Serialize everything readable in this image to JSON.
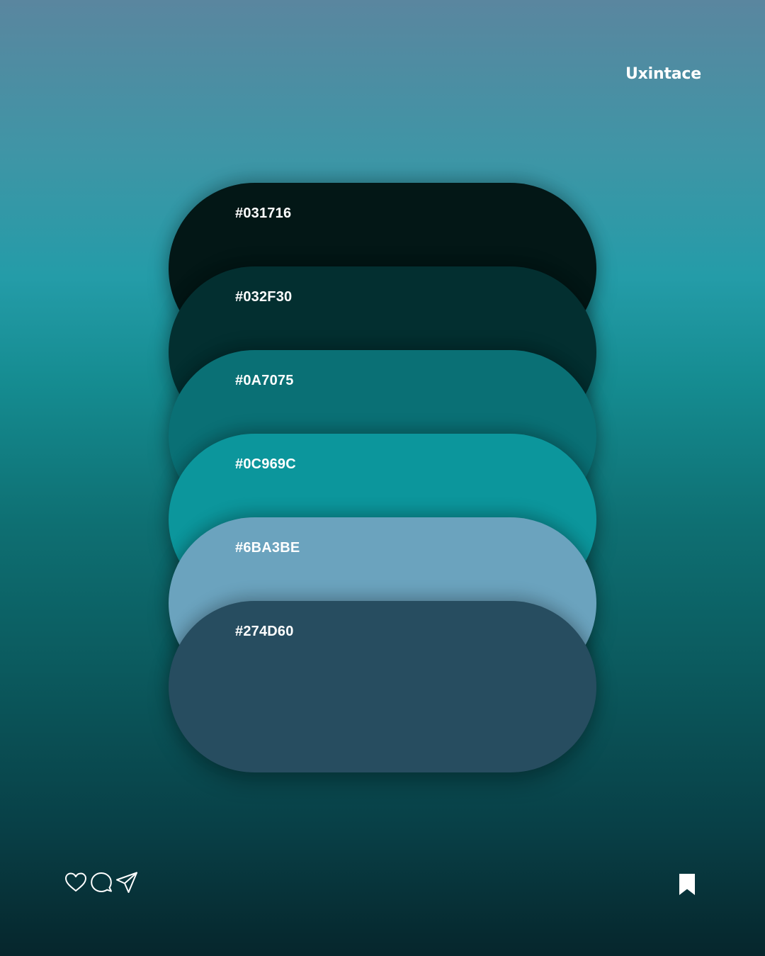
{
  "brand": {
    "name": "Uxintace"
  },
  "palette": {
    "colors": [
      {
        "label": "#031716",
        "hex": "#031716"
      },
      {
        "label": "#032F30",
        "hex": "#032F30"
      },
      {
        "label": "#0A7075",
        "hex": "#0A7075"
      },
      {
        "label": "#0C969C",
        "hex": "#0C969C"
      },
      {
        "label": "#6BA3BE",
        "hex": "#6BA3BE"
      },
      {
        "label": "#274D60",
        "hex": "#274D60"
      }
    ]
  },
  "actions": {
    "icons": [
      "heart-icon",
      "comment-icon",
      "share-icon"
    ],
    "save_icon": "bookmark-icon"
  }
}
